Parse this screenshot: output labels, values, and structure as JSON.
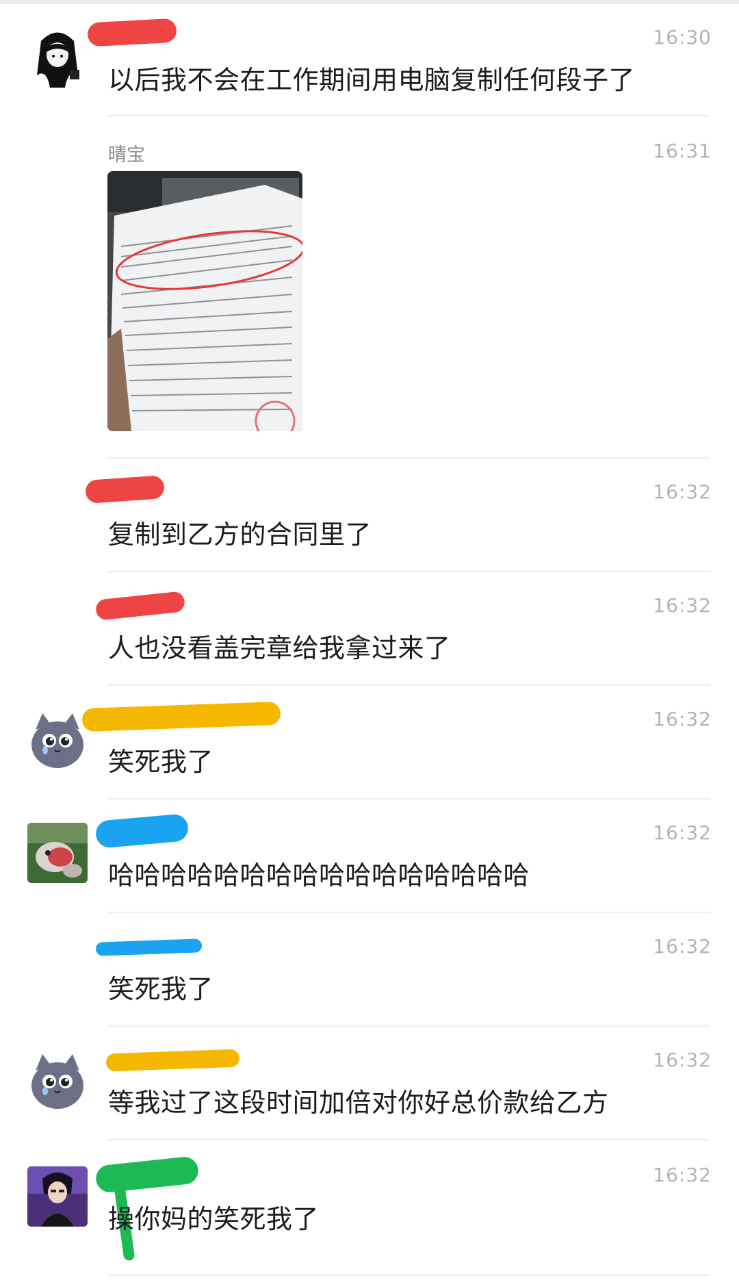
{
  "messages": [
    {
      "time": "16:30",
      "text": "以后我不会在工作期间用电脑复制任何段子了"
    },
    {
      "sender": "晴宝",
      "time": "16:31",
      "image_alt": "photo-of-contract"
    },
    {
      "time": "16:32",
      "text": "复制到乙方的合同里了"
    },
    {
      "time": "16:32",
      "text": "人也没看盖完章给我拿过来了"
    },
    {
      "time": "16:32",
      "text": "笑死我了"
    },
    {
      "time": "16:32",
      "text": "哈哈哈哈哈哈哈哈哈哈哈哈哈哈哈哈"
    },
    {
      "time": "16:32",
      "text": "笑死我了"
    },
    {
      "time": "16:32",
      "text": "等我过了这段时间加倍对你好总价款给乙方"
    },
    {
      "time": "16:32",
      "text": "操你妈的笑死我了"
    }
  ],
  "colors": {
    "redaction_red": "#ef4444",
    "redaction_yellow": "#f5b700",
    "redaction_blue": "#1aa3f0",
    "redaction_green": "#1db954",
    "divider": "#ededed",
    "time_text": "#b3b3b3"
  },
  "icons": [
    "girl-avatar-icon",
    "cat-avatar-icon",
    "fish-avatar-icon",
    "anime-boy-avatar-icon"
  ]
}
